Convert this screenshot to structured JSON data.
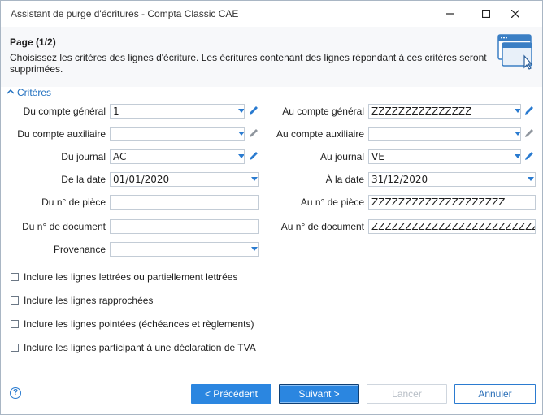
{
  "window": {
    "title": "Assistant de purge d'écritures - Compta Classic CAE"
  },
  "header": {
    "page": "Page (1/2)",
    "description": "Choisissez les critères des lignes d'écriture. Les écritures contenant des lignes répondant à ces critères seront supprimées.",
    "icon": "wizard-window-icon"
  },
  "section": {
    "label": "Critères"
  },
  "fields": {
    "from_account_label": "Du compte général",
    "from_account_value": "1",
    "to_account_label": "Au compte général",
    "to_account_value": "ZZZZZZZZZZZZZZZ",
    "from_aux_label": "Du compte auxiliaire",
    "from_aux_value": "",
    "to_aux_label": "Au compte auxiliaire",
    "to_aux_value": "",
    "from_journal_label": "Du journal",
    "from_journal_value": "AC",
    "to_journal_label": "Au journal",
    "to_journal_value": "VE",
    "from_date_label": "De la date",
    "from_date_value": "01/01/2020",
    "to_date_label": "À la date",
    "to_date_value": "31/12/2020",
    "from_piece_label": "Du n° de pièce",
    "from_piece_value": "",
    "to_piece_label": "Au n° de pièce",
    "to_piece_value": "ZZZZZZZZZZZZZZZZZZZZ",
    "from_doc_label": "Du n° de document",
    "from_doc_value": "",
    "to_doc_label": "Au n° de document",
    "to_doc_value": "ZZZZZZZZZZZZZZZZZZZZZZZZZZZZZZ",
    "origin_label": "Provenance",
    "origin_value": ""
  },
  "checkboxes": [
    {
      "label": "Inclure les lignes lettrées ou partiellement lettrées",
      "checked": false
    },
    {
      "label": "Inclure les lignes rapprochées",
      "checked": false
    },
    {
      "label": "Inclure les lignes pointées (échéances et règlements)",
      "checked": false
    },
    {
      "label": "Inclure les lignes participant à une déclaration de TVA",
      "checked": false
    }
  ],
  "buttons": {
    "previous": "< Précédent",
    "next": "Suivant >",
    "cancel": "Lancer",
    "abort": "Annuler",
    "help": "?"
  },
  "colors": {
    "accent": "#2b86e0",
    "section": "#1f6fbf"
  }
}
